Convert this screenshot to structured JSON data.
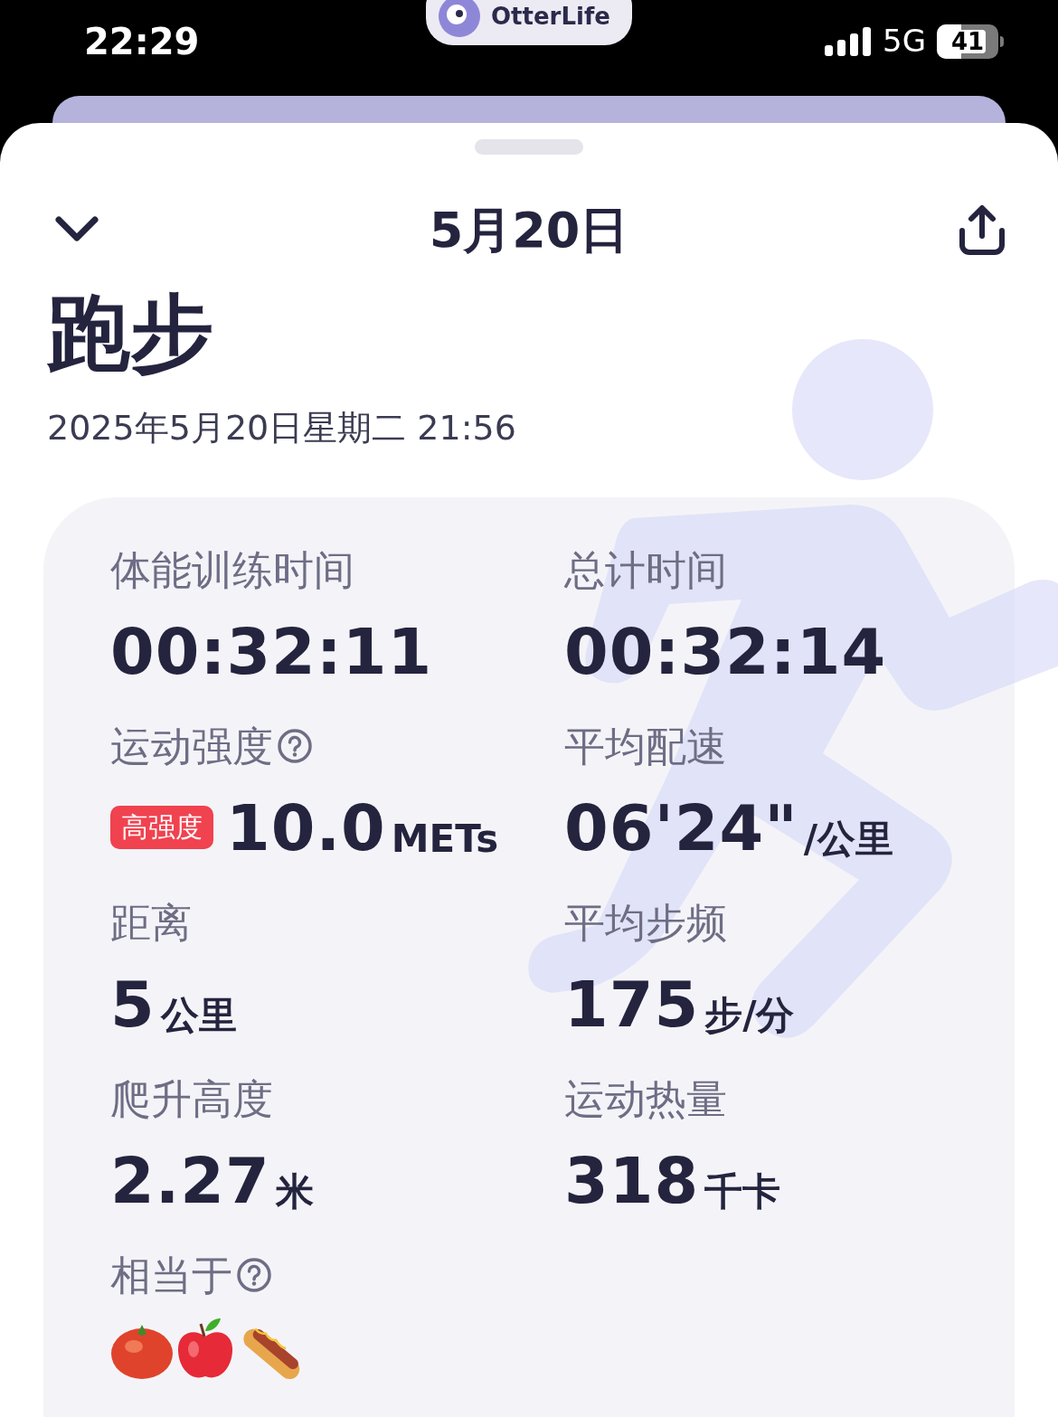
{
  "status_bar": {
    "time": "22:29",
    "app_pill": "OtterLife",
    "network": "5G",
    "battery": "41"
  },
  "header": {
    "title": "5月20日"
  },
  "workout": {
    "title": "跑步",
    "datetime": "2025年5月20日星期二 21:56"
  },
  "stats": [
    {
      "label": "体能训练时间",
      "value": "00:32:11",
      "help": false
    },
    {
      "label": "总计时间",
      "value": "00:32:14",
      "help": false
    },
    {
      "label": "运动强度",
      "value": "10.0",
      "unit": "METs",
      "help": true,
      "badge": {
        "text": "高强度",
        "color": "#f0424f"
      }
    },
    {
      "label": "平均配速",
      "value": "06'24\"",
      "unit": "/公里",
      "help": false
    },
    {
      "label": "距离",
      "value": "5",
      "unit": "公里",
      "help": false
    },
    {
      "label": "平均步频",
      "value": "175",
      "unit": "步/分",
      "help": false
    },
    {
      "label": "爬升高度",
      "value": "2.27",
      "unit": "米",
      "help": false
    },
    {
      "label": "运动热量",
      "value": "318",
      "unit": "千卡",
      "help": false
    }
  ],
  "equivalent": {
    "label": "相当于",
    "help": true,
    "foods": [
      {
        "kind": "tomato"
      },
      {
        "kind": "apple"
      },
      {
        "kind": "hotdog"
      }
    ]
  }
}
